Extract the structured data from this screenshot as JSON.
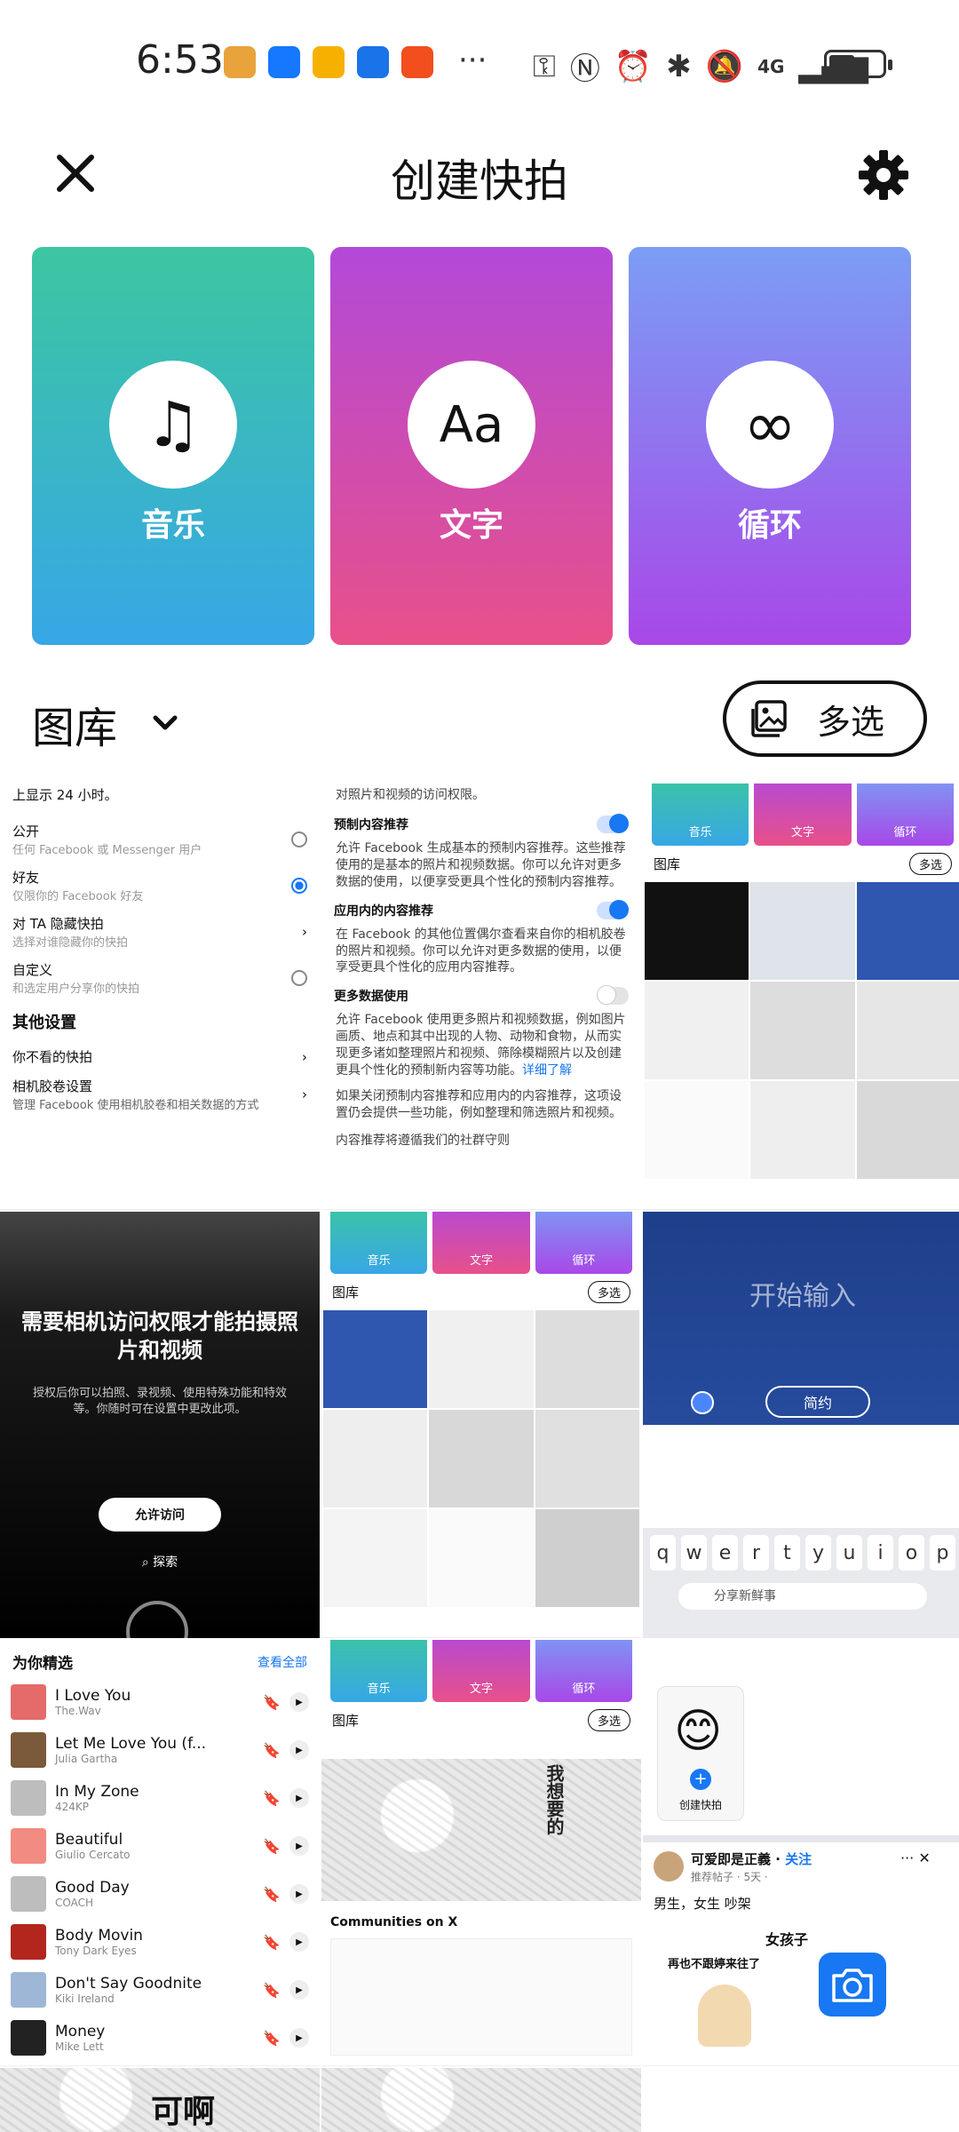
{
  "status_bar": {
    "time": "6:53",
    "more": "···",
    "network": "4G",
    "app_icon_colors": [
      "#e8a33a",
      "#1677ff",
      "#f6b100",
      "#1a73e8",
      "#f24e1e"
    ]
  },
  "header": {
    "title": "创建快拍"
  },
  "modes": [
    {
      "label": "音乐",
      "icon": "music-note-icon",
      "glyph": "♫"
    },
    {
      "label": "文字",
      "icon": "text-aa-icon",
      "glyph": "Aa"
    },
    {
      "label": "循环",
      "icon": "infinity-icon",
      "glyph": "∞"
    }
  ],
  "gallery": {
    "title": "图库",
    "multi_select_label": "多选"
  },
  "thumbs": {
    "privacy": {
      "top_line": "上显示 24 小时。",
      "public_title": "公开",
      "public_sub": "任何 Facebook 或 Messenger 用户",
      "friends_title": "好友",
      "friends_sub": "仅限你的 Facebook 好友",
      "hide_title": "对 TA 隐藏快拍",
      "hide_sub": "选择对谁隐藏你的快拍",
      "custom_title": "自定义",
      "custom_sub": "和选定用户分享你的快拍",
      "other_settings": "其他设置",
      "not_seen": "你不看的快拍",
      "camera_roll_title": "相机胶卷设置",
      "camera_roll_sub": "管理 Facebook 使用相机胶卷和相关数据的方式"
    },
    "recommend": {
      "top_line": "对照片和视频的访问权限。",
      "preset_title": "预制内容推荐",
      "preset_body": "允许 Facebook 生成基本的预制内容推荐。这些推荐使用的是基本的照片和视频数据。你可以允许对更多数据的使用，以便享受更具个性化的预制内容推荐。",
      "inapp_title": "应用内的内容推荐",
      "inapp_body": "在 Facebook 的其他位置偶尔查看来自你的相机胶卷的照片和视频。你可以允许对更多数据的使用，以便享受更具个性化的应用内容推荐。",
      "more_title": "更多数据使用",
      "more_body": "允许 Facebook 使用更多照片和视频数据，例如图片画质、地点和其中出现的人物、动物和食物，从而实现更多诸如整理照片和视频、筛除模糊照片以及创建更具个性化的预制新内容等功能。",
      "learn_more": "详细了解",
      "footer": "如果关闭预制内容推荐和应用内的内容推荐，这项设置仍会提供一些功能，例如整理和筛选照片和视频。",
      "guidelines": "内容推荐将遵循我们的社群守则"
    },
    "camera_perm": {
      "title": "需要相机访问权限才能拍摄照片和视频",
      "body": "授权后你可以拍照、录视频、使用特殊功能和特效等。你随时可在设置中更改此项。",
      "allow": "允许访问",
      "explore": "探索"
    },
    "start_typing": {
      "placeholder": "开始输入",
      "pill": "简约",
      "share_line": "分享新鲜事",
      "keys": [
        "q",
        "w",
        "e",
        "r",
        "t",
        "y",
        "u",
        "i",
        "o",
        "p"
      ]
    },
    "music_list": {
      "header": "为你精选",
      "see_all": "查看全部",
      "tracks": [
        {
          "title": "I Love You",
          "artist": "The.Wav",
          "color": "#e56a6a"
        },
        {
          "title": "Let Me Love You (f...",
          "artist": "Julia Gartha",
          "color": "#7a5a3a"
        },
        {
          "title": "In My Zone",
          "artist": "424KP",
          "color": "#bdbdbd"
        },
        {
          "title": "Beautiful",
          "artist": "Giulio Cercato",
          "color": "#f28b82"
        },
        {
          "title": "Good Day",
          "artist": "COACH",
          "color": "#bdbdbd"
        },
        {
          "title": "Body Movin",
          "artist": "Tony Dark Eyes",
          "color": "#b3261e"
        },
        {
          "title": "Don't Say Goodnite",
          "artist": "Kiki Ireland",
          "color": "#9fb7d6"
        },
        {
          "title": "Money",
          "artist": "Mike Lett",
          "color": "#222"
        }
      ]
    },
    "mini_modes": [
      "音乐",
      "文字",
      "循环"
    ],
    "mini_gallery": "图库",
    "mini_multi": "多选",
    "manga_text_1": "可啊",
    "manga_text_2": "我想要的",
    "communities": "Communities on X",
    "create_story": "创建快拍",
    "post": {
      "author": "可爱即是正義",
      "follow": "关注",
      "meta": "推荐帖子 · 5天 · ",
      "text": "男生，女生 吵架",
      "caption_1": "女孩子",
      "caption_2": "再也不跟婷来往了"
    },
    "bottom_manga": "可啊"
  }
}
